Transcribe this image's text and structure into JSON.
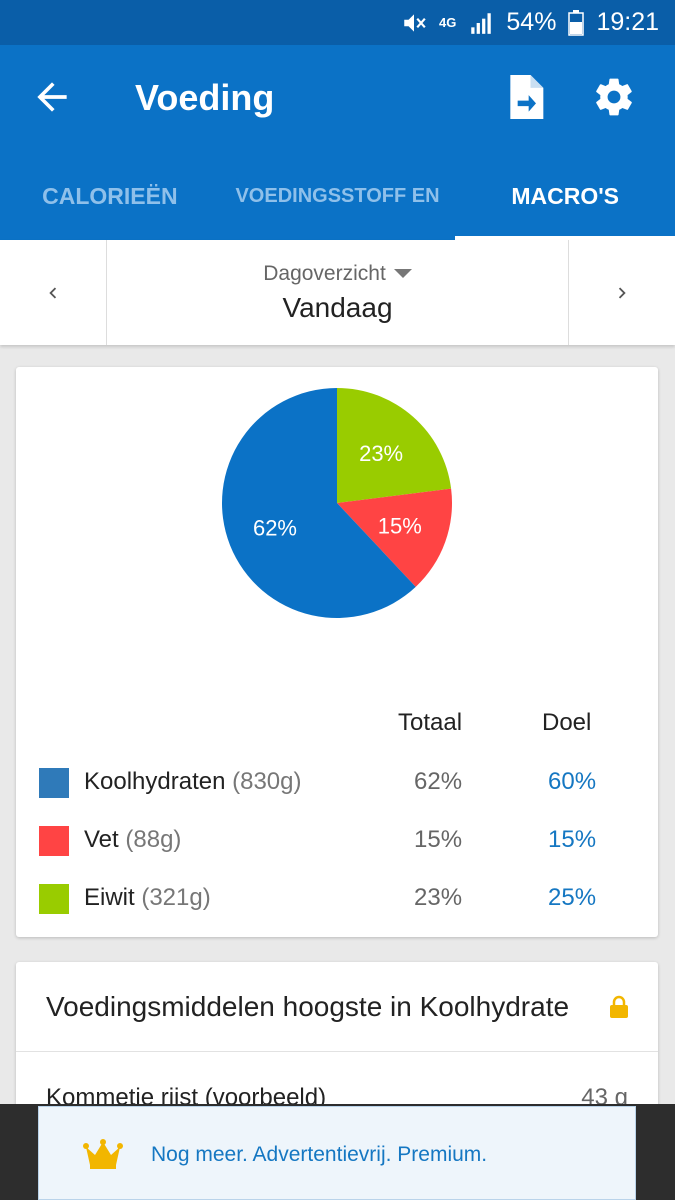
{
  "status_bar": {
    "battery": "54%",
    "time": "19:21",
    "network": "4G"
  },
  "app_bar": {
    "title": "Voeding"
  },
  "tabs": [
    {
      "label": "CALORIEËN"
    },
    {
      "label": "VOEDINGSSTOFF EN"
    },
    {
      "label": "MACRO'S"
    }
  ],
  "date_nav": {
    "sub_label": "Dagoverzicht",
    "main_label": "Vandaag"
  },
  "chart_data": {
    "type": "pie",
    "slices": [
      {
        "label": "23%",
        "value": 23,
        "color": "#99cc00"
      },
      {
        "label": "15%",
        "value": 15,
        "color": "#ff4444"
      },
      {
        "label": "62%",
        "value": 62,
        "color": "#0b72c6"
      }
    ]
  },
  "legend": {
    "header_total": "Totaal",
    "header_goal": "Doel",
    "rows": [
      {
        "name": "Koolhydraten",
        "grams": "(830g)",
        "total": "62%",
        "goal": "60%",
        "color": "#2f7ab9"
      },
      {
        "name": "Vet",
        "grams": "(88g)",
        "total": "15%",
        "goal": "15%",
        "color": "#ff4444"
      },
      {
        "name": "Eiwit",
        "grams": "(321g)",
        "total": "23%",
        "goal": "25%",
        "color": "#99cc00"
      }
    ]
  },
  "foods_card": {
    "title": "Voedingsmiddelen hoogste in Koolhydrate",
    "item_name": "Kommetje rijst (voorbeeld)",
    "item_amount": "43 g"
  },
  "ad": {
    "text": "Nog meer. Advertentievrij. Premium."
  }
}
